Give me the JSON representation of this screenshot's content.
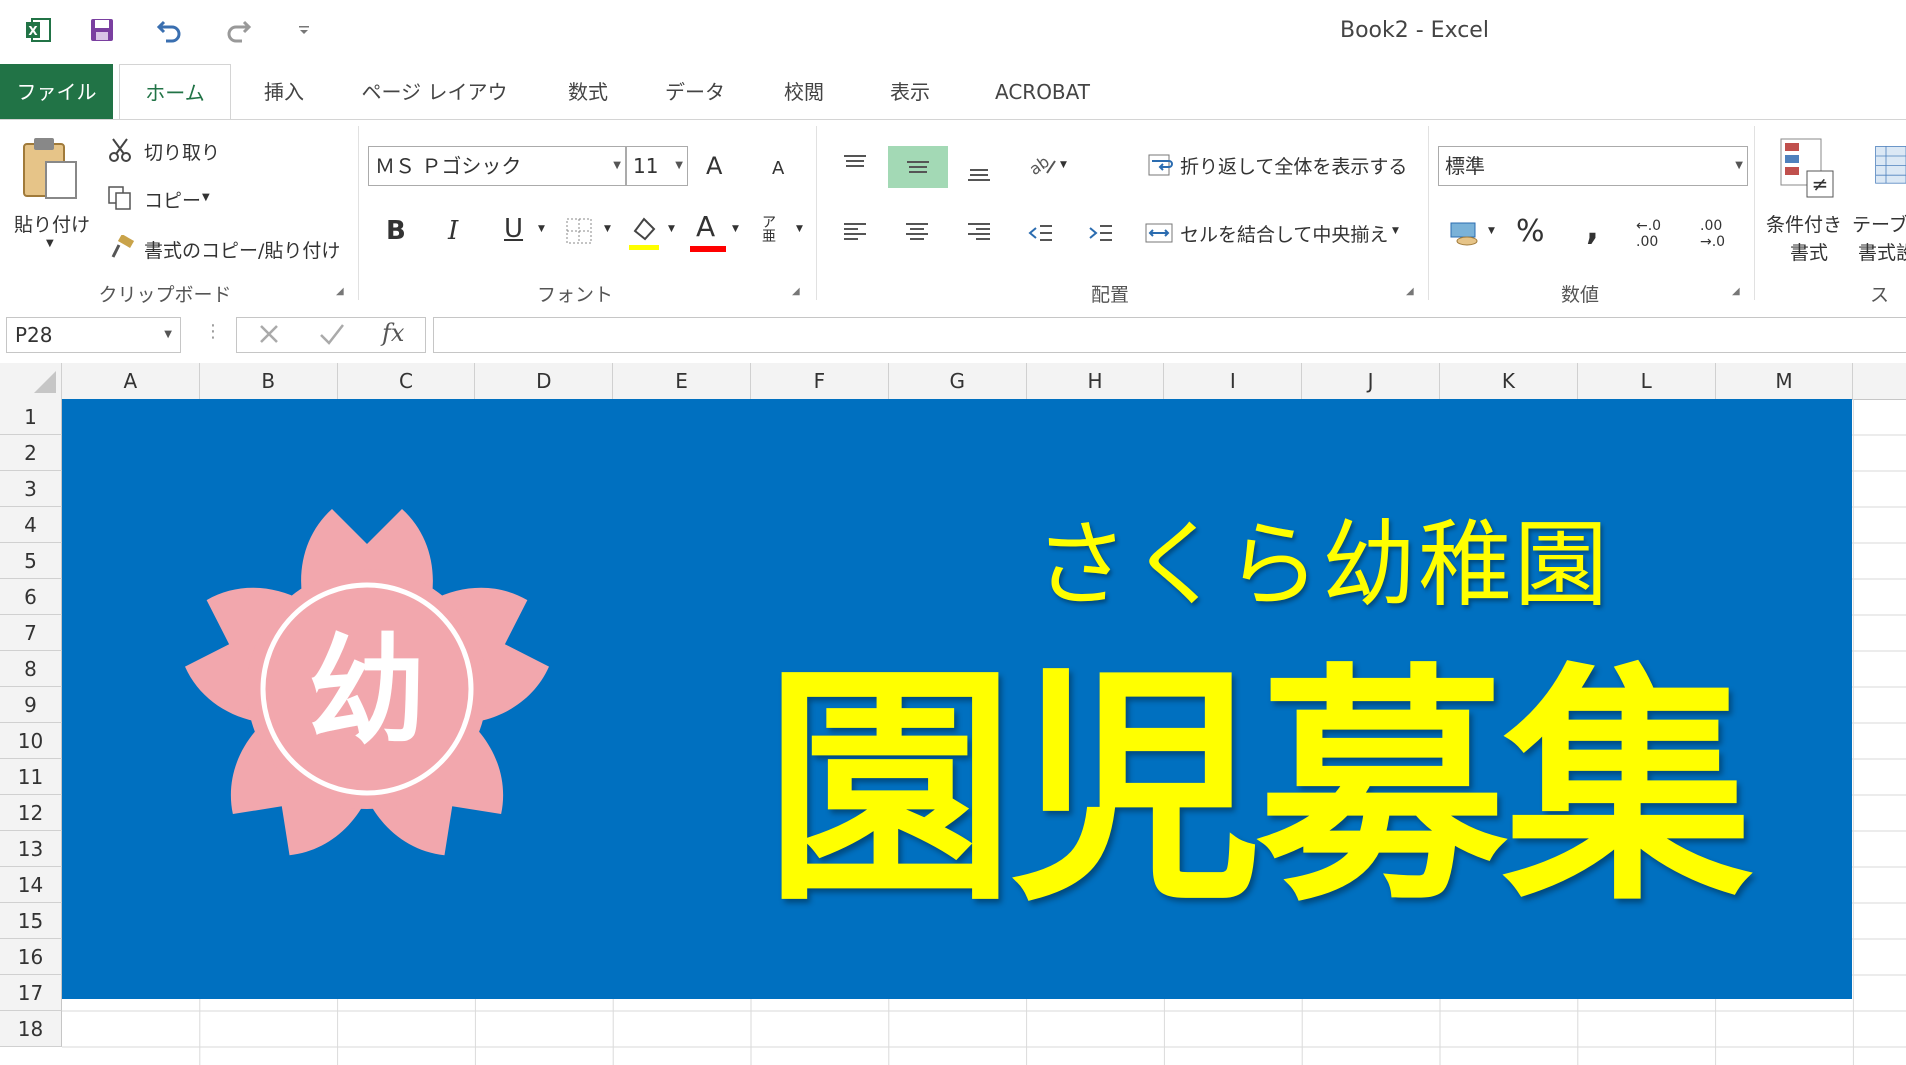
{
  "window": {
    "title": "Book2 - Excel"
  },
  "quick_access": {
    "icons": [
      "excel-logo-icon",
      "save-icon",
      "undo-icon",
      "redo-icon",
      "customize-qat-icon"
    ]
  },
  "tabs": [
    {
      "label": "ファイル"
    },
    {
      "label": "ホーム"
    },
    {
      "label": "挿入"
    },
    {
      "label": "ページ レイアウト"
    },
    {
      "label": "数式"
    },
    {
      "label": "データ"
    },
    {
      "label": "校閲"
    },
    {
      "label": "表示"
    },
    {
      "label": "ACROBAT"
    }
  ],
  "ribbon": {
    "clipboard": {
      "paste": "貼り付け",
      "cut": "切り取り",
      "copy": "コピー",
      "format_painter": "書式のコピー/貼り付け",
      "label": "クリップボード"
    },
    "font": {
      "name": "ＭＳ Ｐゴシック",
      "size": "11",
      "bold": "B",
      "italic": "I",
      "underline": "U",
      "font_color": "A",
      "grow": "A",
      "shrink": "A",
      "phonetic": "ア亜",
      "label": "フォント"
    },
    "alignment": {
      "wrap": "折り返して全体を表示する",
      "merge": "セルを結合して中央揃え",
      "label": "配置"
    },
    "number": {
      "format": "標準",
      "percent": "%",
      "comma": ",",
      "inc_decimal": "←.0 .00",
      "dec_decimal": ".00 →.0",
      "label": "数値"
    },
    "styles": {
      "conditional": "条件付き",
      "conditional_2": "書式",
      "table": "テーブル",
      "table_2": "書式設",
      "label": "スタ"
    }
  },
  "formula_bar": {
    "name_box": "P28",
    "fx": "fx",
    "value": ""
  },
  "grid": {
    "columns": [
      "A",
      "B",
      "C",
      "D",
      "E",
      "F",
      "G",
      "H",
      "I",
      "J",
      "K",
      "L",
      "M"
    ],
    "rows": [
      "1",
      "2",
      "3",
      "4",
      "5",
      "6",
      "7",
      "8",
      "9",
      "10",
      "11",
      "12",
      "13",
      "14",
      "15",
      "16",
      "17",
      "18"
    ]
  },
  "banner": {
    "subtitle": "さくら幼稚園",
    "title": "園児募集",
    "logo_char": "幼",
    "background": "#0070c0",
    "text_color": "#ffff00",
    "flower_color": "#f2a7ad"
  }
}
